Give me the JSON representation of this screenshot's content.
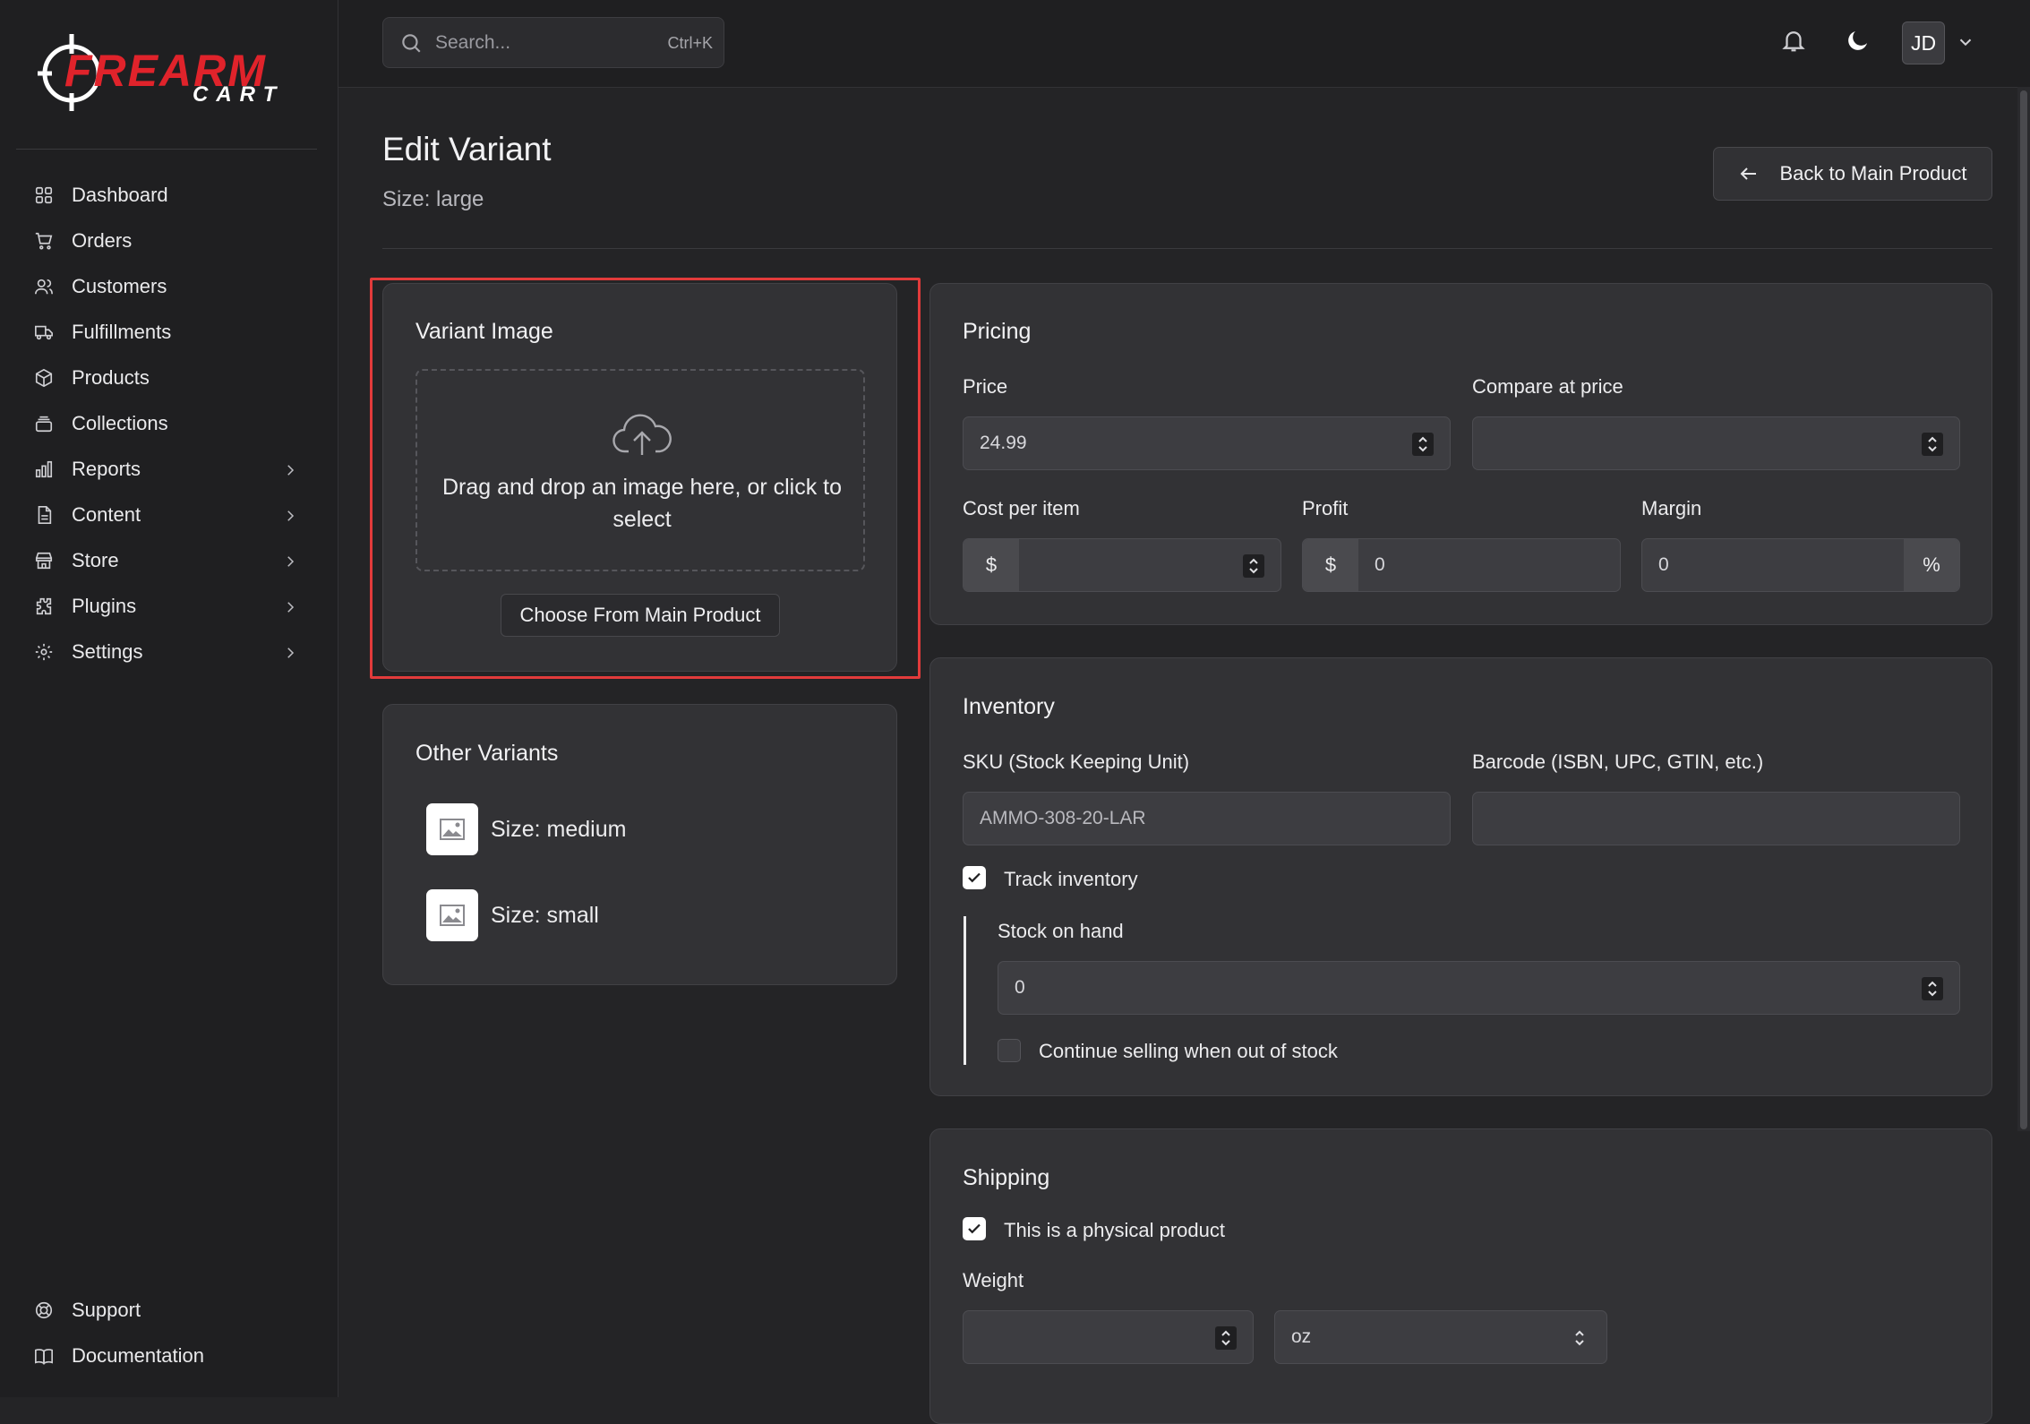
{
  "brand": {
    "name_part1": "F",
    "name_part2": "REARM",
    "name_sub": "CART",
    "accent": "#e0232b"
  },
  "sidebar": {
    "items": [
      {
        "label": "Dashboard",
        "icon": "grid-icon",
        "expandable": false
      },
      {
        "label": "Orders",
        "icon": "cart-icon",
        "expandable": false
      },
      {
        "label": "Customers",
        "icon": "users-icon",
        "expandable": false
      },
      {
        "label": "Fulfillments",
        "icon": "truck-icon",
        "expandable": false
      },
      {
        "label": "Products",
        "icon": "box-icon",
        "expandable": false
      },
      {
        "label": "Collections",
        "icon": "stack-icon",
        "expandable": false
      },
      {
        "label": "Reports",
        "icon": "bar-chart-icon",
        "expandable": true
      },
      {
        "label": "Content",
        "icon": "file-icon",
        "expandable": true
      },
      {
        "label": "Store",
        "icon": "store-icon",
        "expandable": true
      },
      {
        "label": "Plugins",
        "icon": "puzzle-icon",
        "expandable": true
      },
      {
        "label": "Settings",
        "icon": "gear-icon",
        "expandable": true
      }
    ],
    "bottom": [
      {
        "label": "Support",
        "icon": "lifebuoy-icon"
      },
      {
        "label": "Documentation",
        "icon": "book-icon"
      }
    ]
  },
  "topbar": {
    "search_placeholder": "Search...",
    "search_shortcut": "Ctrl+K",
    "avatar_initials": "JD"
  },
  "header": {
    "title": "Edit Variant",
    "subtitle": "Size: large",
    "back_label": "Back to Main Product"
  },
  "variant_image": {
    "title": "Variant Image",
    "dropzone_text": "Drag and drop an image here, or click to select",
    "choose_label": "Choose From Main Product"
  },
  "other_variants": {
    "title": "Other Variants",
    "items": [
      "Size: medium",
      "Size: small"
    ]
  },
  "pricing": {
    "title": "Pricing",
    "price_label": "Price",
    "price_value": "24.99",
    "compare_label": "Compare at price",
    "compare_value": "",
    "cost_label": "Cost per item",
    "cost_prefix": "$",
    "cost_value": "",
    "profit_label": "Profit",
    "profit_prefix": "$",
    "profit_value": "0",
    "margin_label": "Margin",
    "margin_value": "0",
    "margin_suffix": "%"
  },
  "inventory": {
    "title": "Inventory",
    "sku_label": "SKU (Stock Keeping Unit)",
    "sku_value": "AMMO-308-20-LAR",
    "barcode_label": "Barcode (ISBN, UPC, GTIN, etc.)",
    "barcode_value": "",
    "track_label": "Track inventory",
    "track_checked": true,
    "stock_label": "Stock on hand",
    "stock_value": "0",
    "continue_label": "Continue selling when out of stock",
    "continue_checked": false
  },
  "shipping": {
    "title": "Shipping",
    "physical_label": "This is a physical product",
    "physical_checked": true,
    "weight_label": "Weight",
    "weight_value": "",
    "weight_unit": "oz"
  }
}
